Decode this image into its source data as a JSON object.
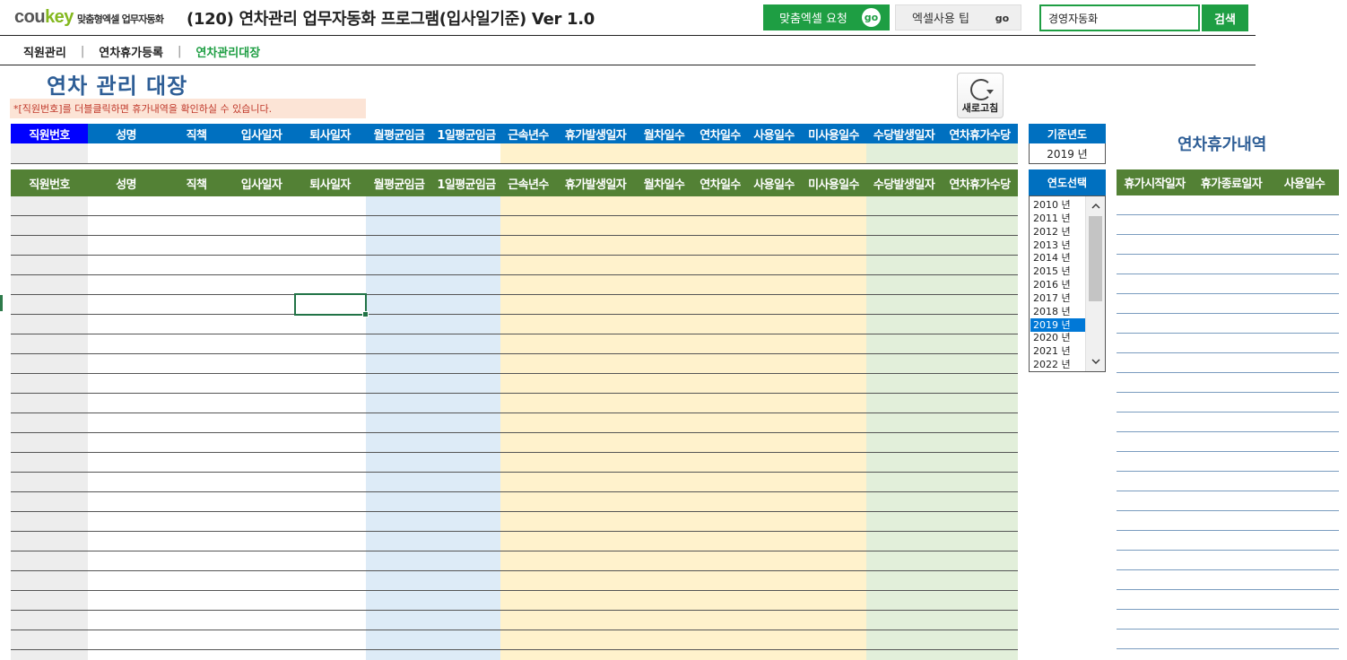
{
  "logo": {
    "brand_part1": "cou",
    "brand_part2": "key",
    "tagline": "맞춤형엑셀 업무자동화"
  },
  "title": "(120) 연차관리 업무자동화 프로그램(입사일기준) Ver 1.0",
  "header_buttons": {
    "request_label": "맞춤엑셀 요청",
    "request_go": "go",
    "tips_label": "엑셀사용 팁",
    "tips_go": "go"
  },
  "search": {
    "value": "경영자동화",
    "button_label": "검색"
  },
  "nav": {
    "items": [
      "직원관리",
      "연차휴가등록",
      "연차관리대장"
    ],
    "separator": "|",
    "active_index": 2
  },
  "page_title": "연차 관리 대장",
  "hint_text": "*[직원번호]를 더블클릭하면 휴가내역을 확인하실 수 있습니다.",
  "refresh_label": "새로고침",
  "table": {
    "columns": [
      "직원번호",
      "성명",
      "직책",
      "입사일자",
      "퇴사일자",
      "월평균임금",
      "1일평균임금",
      "근속년수",
      "휴가발생일자",
      "월차일수",
      "연차일수",
      "사용일수",
      "미사용일수",
      "수당발생일자",
      "연차휴가수당"
    ]
  },
  "year_panel": {
    "base_year_label": "기준년도",
    "base_year_value": "2019 년",
    "select_label": "연도선택",
    "years": [
      "2010 년",
      "2011 년",
      "2012 년",
      "2013 년",
      "2014 년",
      "2015 년",
      "2016 년",
      "2017 년",
      "2018 년",
      "2019 년",
      "2020 년",
      "2021 년",
      "2022 년"
    ],
    "selected_year": "2019 년"
  },
  "leave_panel": {
    "title": "연차휴가내역",
    "columns": [
      "휴가시작일자",
      "휴가종료일자",
      "사용일수"
    ]
  },
  "colors": {
    "accent_green": "#1e9e43",
    "header_blue": "#0070c0",
    "header_green": "#538135",
    "title_blue": "#2e5e96",
    "band_gray": "#ededed",
    "band_blue": "#ddebf7",
    "band_yellow": "#fff2cc",
    "band_green": "#e2efda"
  },
  "icons": {
    "refresh": "refresh-icon",
    "scroll_up": "chevron-up-icon",
    "scroll_down": "chevron-down-icon"
  }
}
